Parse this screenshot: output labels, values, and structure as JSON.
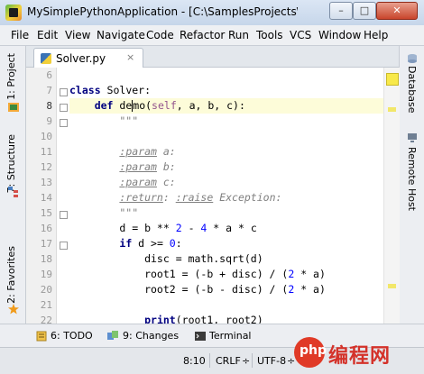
{
  "window": {
    "title": "MySimplePythonApplication - [C:\\SamplesProjects\\py\\MySi...",
    "minimize": "–",
    "maximize": "□",
    "close": "✕"
  },
  "menu": [
    "File",
    "Edit",
    "View",
    "Navigate",
    "Code",
    "Refactor",
    "Run",
    "Tools",
    "VCS",
    "Window",
    "Help"
  ],
  "left_tools": {
    "project": "1: Project",
    "structure": "7: Structure",
    "favorites": "2: Favorites"
  },
  "right_tools": {
    "database": "Database",
    "remote_host": "Remote Host"
  },
  "editor": {
    "tab_label": "Solver.py",
    "tab_close": "×",
    "current_line": 8,
    "lines": [
      {
        "n": "6",
        "text": ""
      },
      {
        "n": "7",
        "text": "class Solver:"
      },
      {
        "n": "8",
        "text": "    def demo(self, a, b, c):"
      },
      {
        "n": "9",
        "text": "        \"\"\""
      },
      {
        "n": "10",
        "text": ""
      },
      {
        "n": "11",
        "text": "        :param a:"
      },
      {
        "n": "12",
        "text": "        :param b:"
      },
      {
        "n": "13",
        "text": "        :param c:"
      },
      {
        "n": "14",
        "text": "        :return: :raise Exception:"
      },
      {
        "n": "15",
        "text": "        \"\"\""
      },
      {
        "n": "16",
        "text": "        d = b ** 2 - 4 * a * c"
      },
      {
        "n": "17",
        "text": "        if d >= 0:"
      },
      {
        "n": "18",
        "text": "            disc = math.sqrt(d)"
      },
      {
        "n": "19",
        "text": "            root1 = (-b + disc) / (2 * a)"
      },
      {
        "n": "20",
        "text": "            root2 = (-b - disc) / (2 * a)"
      },
      {
        "n": "21",
        "text": ""
      },
      {
        "n": "22",
        "text": "            print(root1, root2)"
      }
    ]
  },
  "bottom_tabs": {
    "todo": "6: TODO",
    "changes": "9: Changes",
    "terminal": "Terminal"
  },
  "status": {
    "position": "8:10",
    "line_sep": "CRLF",
    "line_sep_arrow": "÷",
    "encoding": "UTF-8",
    "encoding_arrow": "÷"
  },
  "watermark": {
    "logo": "php",
    "text": "编程网"
  },
  "colors": {
    "keyword": "#000080",
    "number": "#0000ff",
    "docstring": "#808080",
    "caret_line": "#fdfcd9"
  }
}
